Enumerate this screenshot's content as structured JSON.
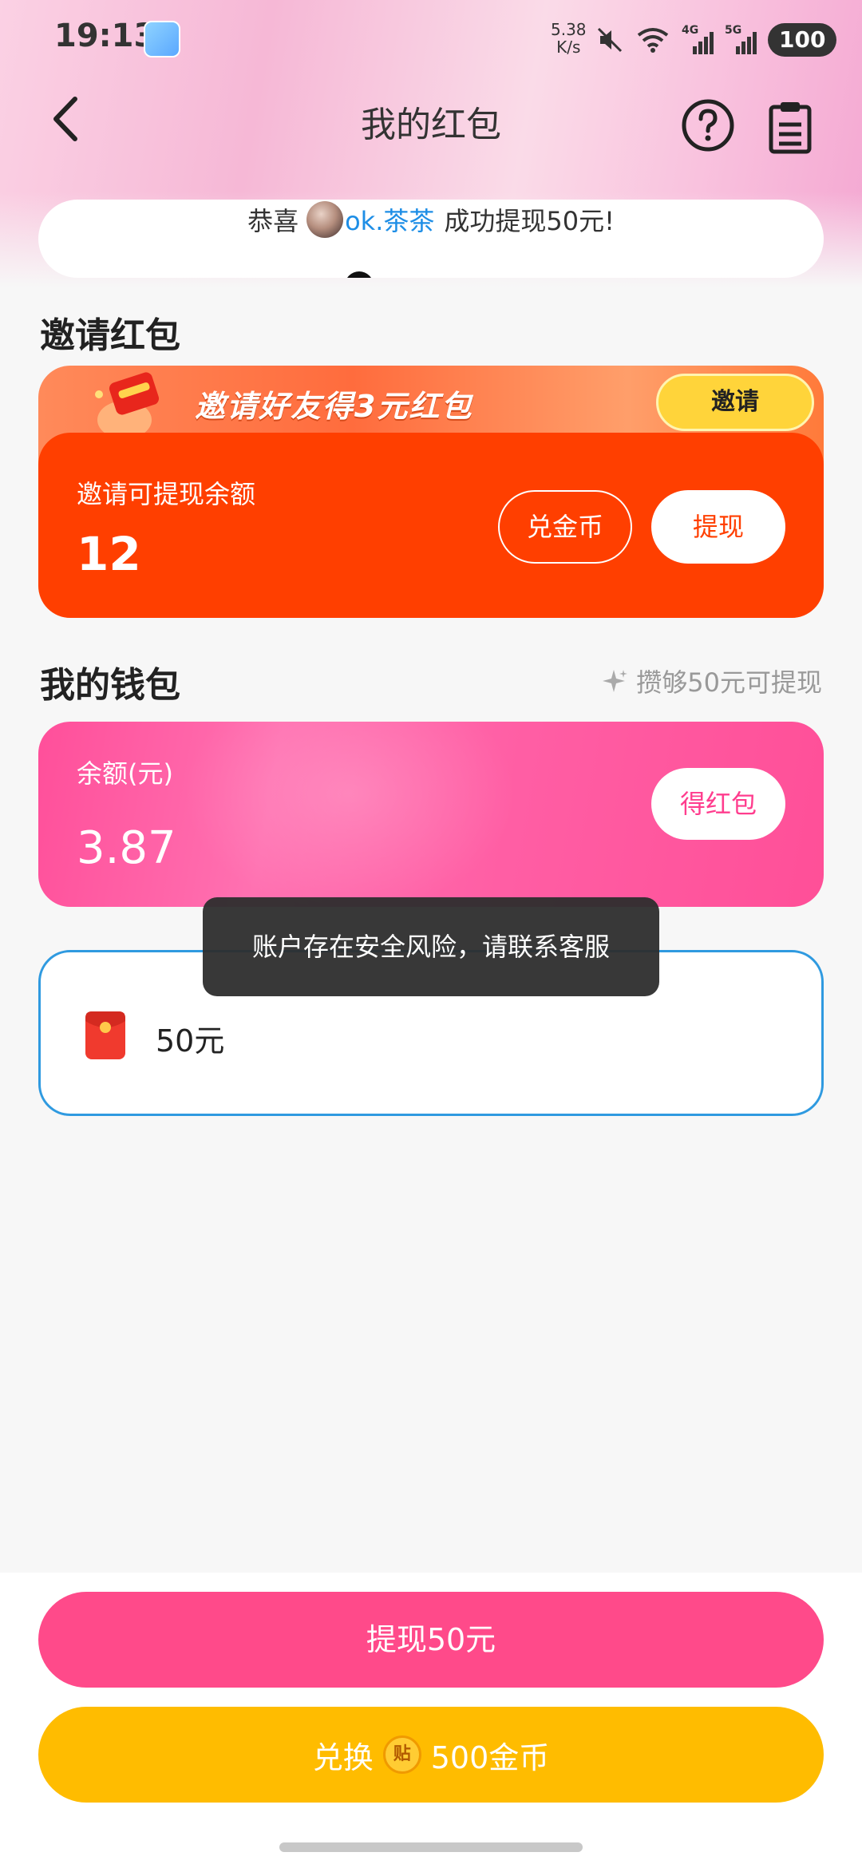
{
  "status_bar": {
    "time": "19:13",
    "speed_value": "5.38",
    "speed_unit": "K/s",
    "network_1": "4G",
    "network_2": "5G",
    "battery": "100"
  },
  "header": {
    "title": "我的红包"
  },
  "marquee": {
    "prefix": "恭喜",
    "user": "ok.茶茶",
    "suffix": "成功提现50元!"
  },
  "invite_section": {
    "title": "邀请红包",
    "banner_text": "邀请好友得3元红包",
    "invite_button": "邀请",
    "balance_label": "邀请可提现余额",
    "balance_value": "12",
    "exchange_coin_button": "兑金币",
    "withdraw_button": "提现"
  },
  "wallet_section": {
    "title": "我的钱包",
    "hint": "攒够50元可提现",
    "balance_label": "余额(元)",
    "balance_value": "3.87",
    "get_redpacket_button": "得红包"
  },
  "withdraw_option": {
    "label": "50元"
  },
  "toast": {
    "message": "账户存在安全风险，请联系客服"
  },
  "bottom": {
    "withdraw_button": "提现50元",
    "exchange_prefix": "兑换",
    "coin_badge": "贴",
    "exchange_amount": "500金币"
  },
  "colors": {
    "invite_orange": "#ff3f00",
    "wallet_pink": "#ff5ea4",
    "withdraw_pink": "#ff4a8a",
    "exchange_yellow": "#ffbc00",
    "option_border_blue": "#2f9ae0"
  },
  "icons": {
    "back": "chevron-left-icon",
    "help": "question-circle-icon",
    "record": "clipboard-icon",
    "sparkle": "sparkle-icon",
    "red_packet": "red-packet-icon"
  }
}
